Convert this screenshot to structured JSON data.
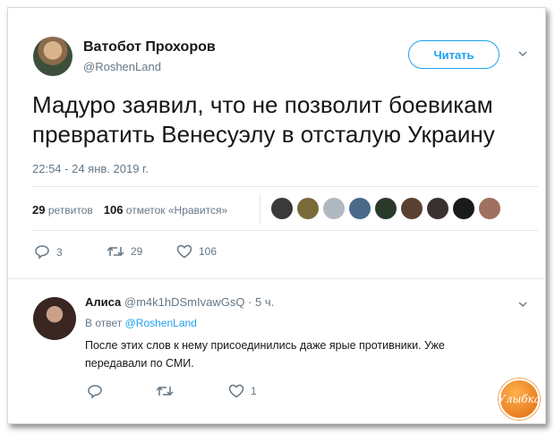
{
  "tweet": {
    "author_name": "Ватобот Прохоров",
    "author_handle": "@RoshenLand",
    "follow_label": "Читать",
    "text": "Мадуро заявил, что не позволит боевикам превратить Венесуэлу в отсталую Украину",
    "timestamp": "22:54 - 24 янв. 2019 г.",
    "stats": {
      "retweets_count": "29",
      "retweets_label": "ретвитов",
      "likes_count": "106",
      "likes_label": "отметок «Нравится»"
    },
    "likers_colors": [
      "#3a3a3a",
      "#7a6a3a",
      "#b0b8c0",
      "#4a6a8a",
      "#2a3a2a",
      "#5a4030",
      "#3a3030",
      "#1a1a1a",
      "#a07060"
    ],
    "actions": {
      "reply": "3",
      "retweet": "29",
      "like": "106"
    }
  },
  "reply": {
    "author_name": "Алиса",
    "author_handle": "@m4k1hDSmIvawGsQ",
    "time": "· 5 ч.",
    "reply_to_prefix": "В ответ",
    "reply_to_handle": "@RoshenLand",
    "text": "После этих слов к нему присоединились даже ярые противники. Уже передавали по СМИ.",
    "actions": {
      "reply": "",
      "retweet": "",
      "like": "1"
    }
  },
  "watermark": "Улыбка",
  "colors": {
    "accent": "#1da1f2",
    "muted": "#657786",
    "badge": "#f08a24"
  }
}
